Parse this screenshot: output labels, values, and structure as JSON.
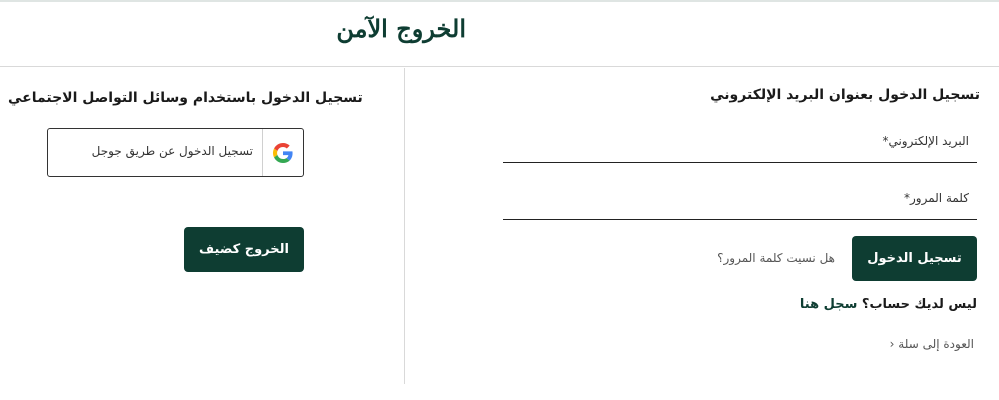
{
  "page": {
    "title": "الخروج الآمن"
  },
  "email_login": {
    "heading": "تسجيل الدخول بعنوان البريد الإلكتروني",
    "email_label": "البريد الإلكتروني*",
    "password_label": "كلمة المرور*",
    "login_button": "تسجيل الدخول",
    "forgot_password": "هل نسيت كلمة المرور؟",
    "no_account": "ليس لديك حساب؟",
    "register_link": "سجل هنا",
    "back_to_cart": "العودة إلى سلة",
    "back_chevron": "‹"
  },
  "social_login": {
    "heading": "تسجيل الدخول باستخدام وسائل التواصل الاجتماعي",
    "google_button": "تسجيل الدخول عن طريق جوجل",
    "guest_button": "الخروج كضيف"
  },
  "colors": {
    "accent": "#0e3d32",
    "divider": "#d9d9d9"
  },
  "icons": {
    "google": "google-icon",
    "back": "chevron-left-icon"
  }
}
